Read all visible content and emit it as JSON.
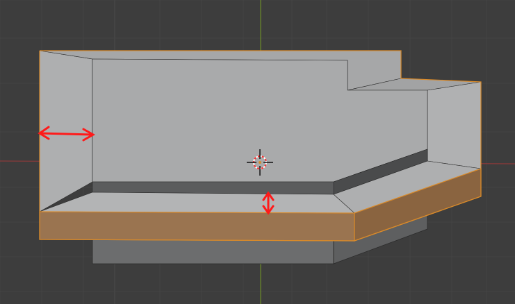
{
  "viewport": {
    "background": "#3d3d3d",
    "grid_minor_color": "#444444",
    "grid_major_color": "#4a4a4a",
    "x_axis_color": "#8a3a3a",
    "y_axis_color": "#6b8a2a"
  },
  "model": {
    "face_light": "#a9aaab",
    "face_mid": "#9fa0a1",
    "face_shadow": "#5b5c5d",
    "face_dark": "#4a4b4c",
    "face_lower": "#6c6d6e",
    "selected_face": "#9a7450",
    "selected_face_dark": "#8a6440",
    "selected_edge": "#d98a2a",
    "edge_color": "#2a2a2a"
  },
  "annotations": {
    "arrow_color": "#ff1a1a",
    "arrow_names": [
      "inset-width-arrow",
      "floor-height-arrow"
    ]
  },
  "cursor": {
    "icon": "3d-cursor-icon",
    "ring_color_a": "#ff3030",
    "ring_color_b": "#ffffff",
    "crosshair_color": "#111111"
  }
}
